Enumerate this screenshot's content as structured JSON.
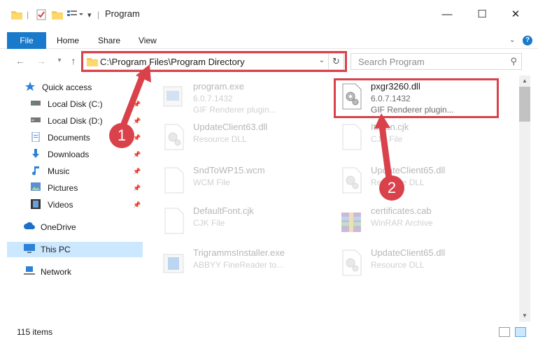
{
  "window": {
    "title": "Program",
    "minimize_glyph": "—",
    "maximize_glyph": "☐",
    "close_glyph": "✕"
  },
  "ribbon": {
    "tabs": [
      "File",
      "Home",
      "Share",
      "View"
    ]
  },
  "navigation": {
    "address": "C:\\Program Files\\Program Directory",
    "search_placeholder": "Search Program"
  },
  "sidebar": {
    "items": [
      {
        "label": "Quick access",
        "icon": "star-icon"
      },
      {
        "label": "Local Disk (C:)",
        "icon": "drive-icon",
        "pinned": true
      },
      {
        "label": "Local Disk (D:)",
        "icon": "drive-icon",
        "pinned": true
      },
      {
        "label": "Documents",
        "icon": "documents-icon",
        "pinned": true
      },
      {
        "label": "Downloads",
        "icon": "download-icon",
        "pinned": true
      },
      {
        "label": "Music",
        "icon": "music-icon",
        "pinned": true
      },
      {
        "label": "Pictures",
        "icon": "pictures-icon",
        "pinned": true
      },
      {
        "label": "Videos",
        "icon": "videos-icon",
        "pinned": true
      },
      {
        "label": "OneDrive",
        "icon": "cloud-icon"
      },
      {
        "label": "This PC",
        "icon": "computer-icon",
        "selected": true
      },
      {
        "label": "Network",
        "icon": "network-icon"
      }
    ]
  },
  "files": [
    {
      "name": "program.exe",
      "line1": "6.0.7.1432",
      "line2": "GIF Renderer plugin...",
      "icon": "exe-icon"
    },
    {
      "name": "pxgr3260.dll",
      "line1": "6.0.7.1432",
      "line2": "GIF Renderer plugin...",
      "icon": "dll-gear-icon",
      "highlighted": true
    },
    {
      "name": "UpdateClient63.dll",
      "line1": "Resource DLL",
      "line2": "",
      "icon": "dll-gear-icon"
    },
    {
      "name": "Italian.cjk",
      "line1": "CJK File",
      "line2": "",
      "icon": "blank-file-icon"
    },
    {
      "name": "SndToWP15.wcm",
      "line1": "WCM File",
      "line2": "",
      "icon": "blank-file-icon"
    },
    {
      "name": "UpdateClient65.dll",
      "line1": "Resource DLL",
      "line2": "",
      "icon": "dll-gear-icon"
    },
    {
      "name": "DefaultFont.cjk",
      "line1": "CJK File",
      "line2": "",
      "icon": "blank-file-icon"
    },
    {
      "name": "certificates.cab",
      "line1": "WinRAR Archive",
      "line2": "",
      "icon": "winrar-icon"
    },
    {
      "name": "TrigrammsInstaller.exe",
      "line1": "ABBYY FineReader to...",
      "line2": "",
      "icon": "installer-icon"
    },
    {
      "name": "UpdateClient65.dll",
      "line1": "Resource DLL",
      "line2": "",
      "icon": "dll-gear-icon"
    }
  ],
  "status": {
    "item_count": "115 items"
  },
  "callouts": [
    "1",
    "2"
  ],
  "colors": {
    "accent": "#1979ca",
    "annotation": "#d9414b",
    "selection": "#cce8ff"
  }
}
